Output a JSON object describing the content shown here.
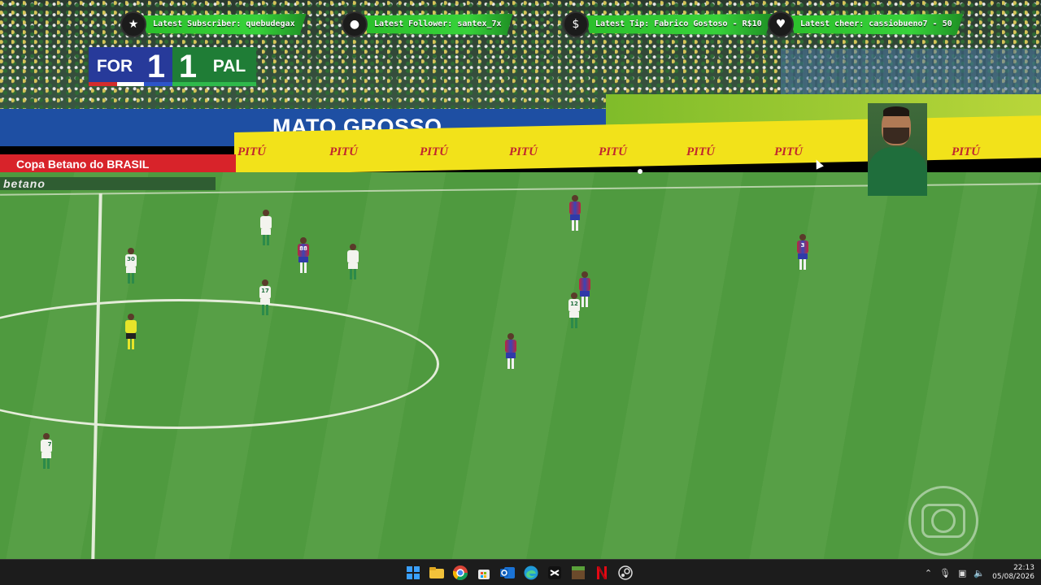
{
  "broadcast": {
    "venue_board": "MATO GROSSO",
    "sponsor_board": "PITÚ",
    "competition_board": "Copa Betano do BRASIL",
    "betano_band": "betano",
    "watermark": "globo-logo"
  },
  "alerts": [
    {
      "icon": "star-icon",
      "text": "Latest Subscriber: quebudegax"
    },
    {
      "icon": "person-icon",
      "text": "Latest Follower: santex_7x"
    },
    {
      "icon": "dollar-icon",
      "text": "Latest Tip: Fabrico Gostoso - R$10"
    },
    {
      "icon": "heart-icon",
      "text": "Latest cheer: cassiobueno7 - 50"
    }
  ],
  "scoreboard": {
    "home_team": "FOR",
    "home_score": "1",
    "away_team": "PAL",
    "away_score": "1",
    "home_color": "#273a9a",
    "away_color": "#1f7d36"
  },
  "player_numbers": [
    "30",
    "88",
    "17",
    "12",
    "3",
    "7"
  ],
  "taskbar": {
    "apps": [
      "windows-start-icon",
      "file-explorer-icon",
      "chrome-icon",
      "store-icon",
      "outlook-icon",
      "edge-icon",
      "capcut-icon",
      "minecraft-icon",
      "netflix-icon",
      "steam-icon"
    ],
    "time": "22:13",
    "date": "05/08/2026"
  }
}
